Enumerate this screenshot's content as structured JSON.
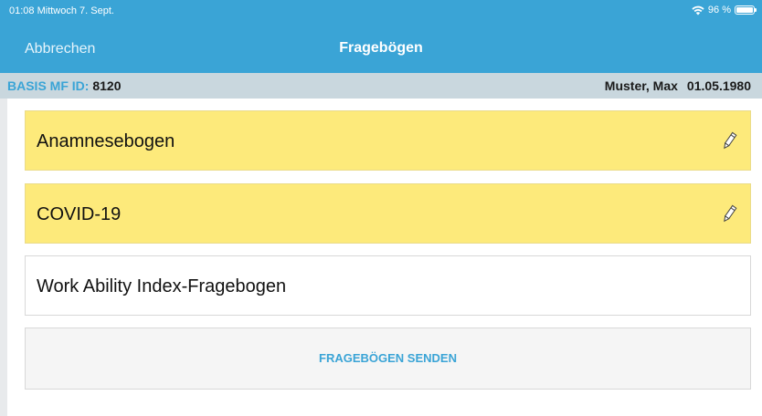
{
  "status_bar": {
    "time_date": "01:08  Mittwoch 7. Sept.",
    "battery_label": "96 %"
  },
  "nav": {
    "cancel_label": "Abbrechen",
    "title": "Fragebögen"
  },
  "info_bar": {
    "id_label": "BASIS MF ID:",
    "id_value": "8120",
    "patient_name": "Muster, Max",
    "birth_date": "01.05.1980"
  },
  "questionnaires": [
    {
      "label": "Anamnesebogen",
      "highlighted": true,
      "icon": "pencil-icon"
    },
    {
      "label": "COVID-19",
      "highlighted": true,
      "icon": "pencil-icon"
    },
    {
      "label": "Work Ability Index-Fragebogen",
      "highlighted": false
    }
  ],
  "send_button_label": "FRAGEBÖGEN SENDEN",
  "colors": {
    "accent": "#3aa4d6",
    "highlight": "#fdea7b",
    "info_bar": "#c9d7de"
  }
}
